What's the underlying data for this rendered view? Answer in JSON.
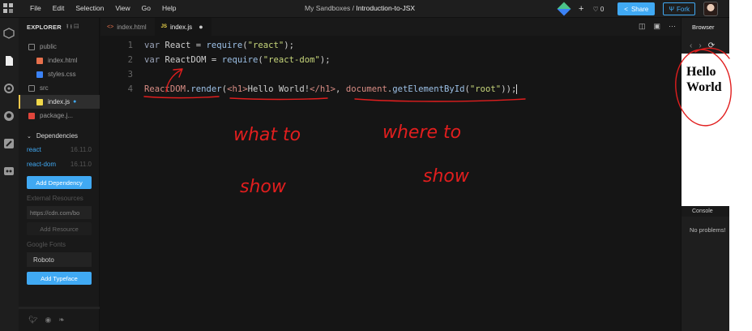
{
  "menu": [
    "File",
    "Edit",
    "Selection",
    "View",
    "Go",
    "Help"
  ],
  "title": {
    "prefix": "My Sandboxes /",
    "name": "Introduction-to-JSX"
  },
  "topbar": {
    "plus": "+",
    "heart_icon": "heart-icon",
    "likes": "0",
    "share": "Share",
    "fork": "Fork"
  },
  "explorer": {
    "title": "EXPLORER",
    "files": [
      {
        "name": "public",
        "type": "folder"
      },
      {
        "name": "index.html",
        "type": "html"
      },
      {
        "name": "styles.css",
        "type": "css"
      },
      {
        "name": "src",
        "type": "folder"
      },
      {
        "name": "index.js",
        "type": "js",
        "modified": "●"
      },
      {
        "name": "package.j...",
        "type": "json"
      }
    ],
    "dependencies_label": "Dependencies",
    "dependencies": [
      {
        "name": "react",
        "version": "16.11.0"
      },
      {
        "name": "react-dom",
        "version": "16.11.0"
      }
    ],
    "add_dependency": "Add Dependency",
    "external_resources_label": "External Resources",
    "external_placeholder": "https://cdn.com/bo",
    "add_resource": "Add Resource",
    "google_fonts_label": "Google Fonts",
    "font_value": "Roboto",
    "add_typeface": "Add Typeface"
  },
  "tabs": [
    {
      "label": "index.html",
      "icon": "<>"
    },
    {
      "label": "index.js",
      "icon": "JS",
      "dirty": "●"
    }
  ],
  "editor": {
    "line_numbers": [
      "1",
      "2",
      "3",
      "4"
    ],
    "line1": {
      "kw": "var",
      "rest": " React = ",
      "fn": "require",
      "open": "(",
      "str": "\"react\"",
      "close": ");"
    },
    "line2": {
      "kw": "var",
      "rest": " ReactDOM = ",
      "fn": "require",
      "open": "(",
      "str": "\"react-dom\"",
      "close": ");"
    },
    "line4": {
      "obj": "ReactDOM",
      "dot1": ".",
      "method": "render",
      "paren": "(",
      "tag_open": "<h1>",
      "text": "Hello World!",
      "tag_close": "</h1>",
      "comma": ", ",
      "doc": "document",
      "dot2": ".",
      "getter": "getElementById",
      "arg_open": "(",
      "arg": "\"root\"",
      "arg_close": ")",
      "end": ");"
    }
  },
  "browser": {
    "title": "Browser",
    "back": "‹",
    "forward": "›",
    "refresh": "⟳",
    "heading": "Hello World",
    "console_label": "Console",
    "console_message": "No problems!"
  },
  "annotations": {
    "what_to_show": "what to show",
    "where_to_show": "where to show",
    "ink_color": "#e11e1e"
  },
  "colors": {
    "accent": "#40a9f3",
    "active_file_marker": "#f0c74d",
    "modified_dot": "#40a9f3"
  }
}
